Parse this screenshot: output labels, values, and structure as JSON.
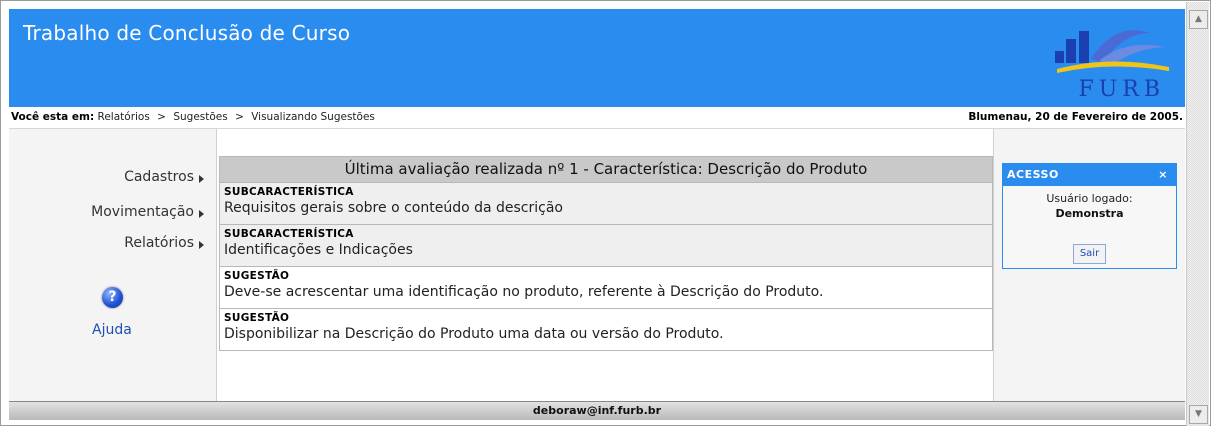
{
  "header": {
    "title": "Trabalho de Conclusão de Curso",
    "logo_text": "FURB",
    "brand_color": "#2b8cf0"
  },
  "breadcrumb": {
    "label": "Você esta em:",
    "items": [
      "Relatórios",
      "Sugestões",
      "Visualizando Sugestões"
    ],
    "separator": ">",
    "date": "Blumenau, 20 de Fevereiro de 2005."
  },
  "menu": {
    "items": [
      "Cadastros",
      "Movimentação",
      "Relatórios"
    ],
    "help_label": "Ajuda",
    "help_icon": "question-icon"
  },
  "main": {
    "table_title": "Última avaliação realizada nº 1 - Característica: Descrição do Produto",
    "rows": [
      {
        "label": "SUBCARACTERÍSTICA",
        "text": "Requisitos gerais sobre o conteúdo da descrição"
      },
      {
        "label": "SUBCARACTERÍSTICA",
        "text": "Identificações e Indicações"
      },
      {
        "label": "SUGESTÃO",
        "text": "Deve-se acrescentar uma identificação no produto, referente à Descrição do Produto."
      },
      {
        "label": "SUGESTÃO",
        "text": "Disponibilizar na Descrição do Produto uma data ou versão do Produto."
      }
    ]
  },
  "access": {
    "title": "ACESSO",
    "close_icon": "×",
    "user_label": "Usuário logado:",
    "user_name": "Demonstra",
    "logout_label": "Sair"
  },
  "footer": {
    "email": "deboraw@inf.furb.br"
  },
  "scrollbar": {
    "up_icon": "▲",
    "down_icon": "▼"
  }
}
